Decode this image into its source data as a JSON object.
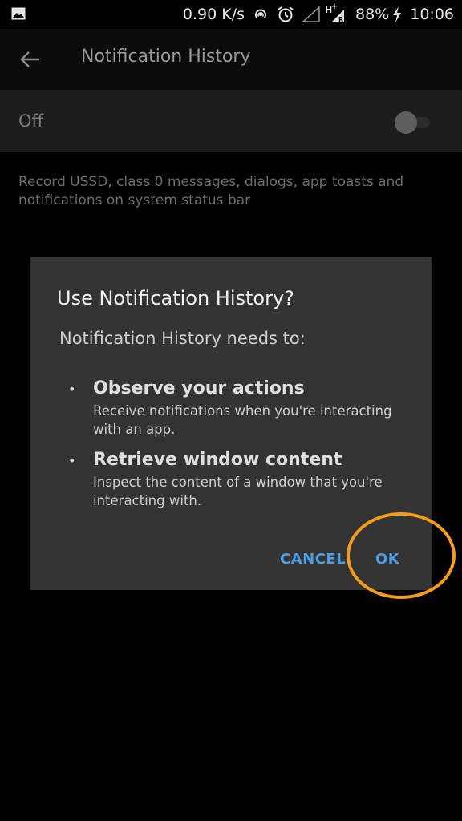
{
  "status_bar": {
    "network_speed": "0.90 K/s",
    "network_type": "H",
    "network_badge": "+",
    "roaming_badge": "R",
    "battery": "88%",
    "time": "10:06"
  },
  "toolbar": {
    "title": "Notification History"
  },
  "master_switch": {
    "label": "Off",
    "checked": false
  },
  "description": "Record USSD, class 0 messages, dialogs, app toasts and notifications on system status bar",
  "dialog": {
    "title": "Use Notification History?",
    "subtitle": "Notification History needs to:",
    "capabilities": [
      {
        "bullet": "•",
        "title": "Observe your actions",
        "description": "Receive notifications when you're interacting with an app."
      },
      {
        "bullet": "•",
        "title": "Retrieve window content",
        "description": "Inspect the content of a window that you're interacting with."
      }
    ],
    "cancel_label": "CANCEL",
    "ok_label": "OK"
  },
  "colors": {
    "accent": "#4a9fe8",
    "annotation": "#f39c1d",
    "dialog_bg": "#333333"
  },
  "icons": {
    "status_left": "gallery-icon",
    "back": "back-arrow-icon"
  }
}
